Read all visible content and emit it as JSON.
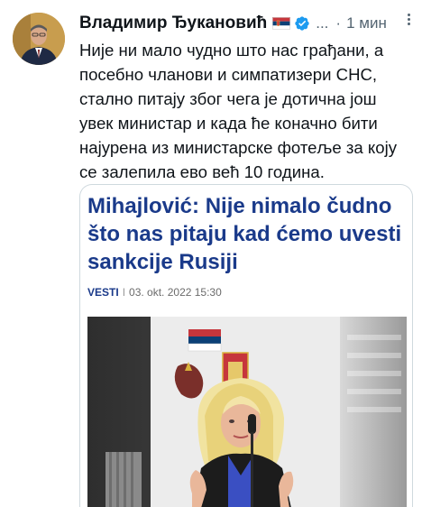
{
  "tweet": {
    "author_name": "Владимир Ђукановић",
    "handle": "...",
    "separator": "·",
    "time": "1 мин",
    "text": "Није ни мало чудно што нас грађани, а посебно чланови и симпатизери СНС, стално питају због чега је дотична још увек министар и када ће коначно бити најурена из министарске фотеље за коју се залепила ево већ 10 година."
  },
  "link_card": {
    "headline": "Mihajlović: Nije nimalo čudno što nas pitaju kad ćemo uvesti sankcije Rusiji",
    "section": "VESTI",
    "separator": "I",
    "date": "03. okt. 2022 15:30"
  },
  "colors": {
    "headline": "#1a3a8a",
    "verified": "#1d9bf0",
    "muted": "#536471"
  }
}
